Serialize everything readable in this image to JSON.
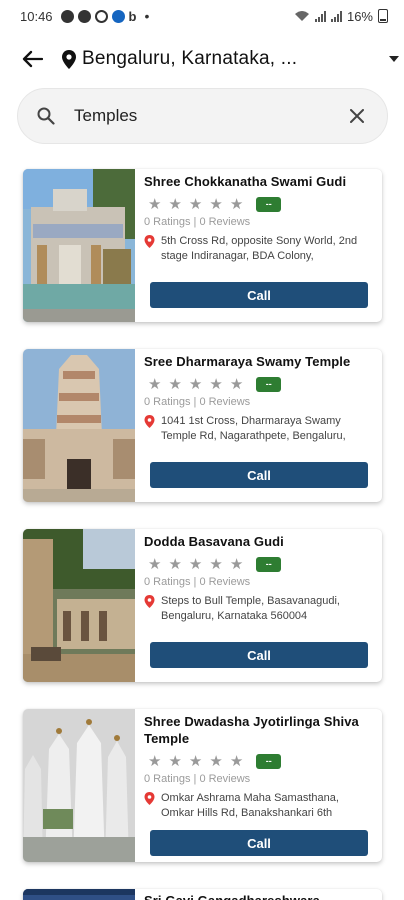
{
  "status_bar": {
    "time": "10:46",
    "extra": "b",
    "dot": "•",
    "battery": "16%"
  },
  "header": {
    "location": "Bengaluru, Karnataka, ..."
  },
  "search": {
    "value": "Temples",
    "placeholder": ""
  },
  "colors": {
    "call_button": "#1f4e79",
    "badge": "#2e7d32",
    "pin": "#e53935"
  },
  "results": [
    {
      "name": "Shree Chokkanatha Swami Gudi",
      "rating_badge": "--",
      "ratings_text": "0 Ratings | 0 Reviews",
      "address": "5th Cross Rd, opposite Sony World, 2nd stage Indiranagar, BDA Colony,",
      "call_label": "Call"
    },
    {
      "name": "Sree Dharmaraya Swamy Temple",
      "rating_badge": "--",
      "ratings_text": "0 Ratings | 0 Reviews",
      "address": "1041 1st Cross, Dharmaraya Swamy Temple Rd, Nagarathpete, Bengaluru,",
      "call_label": "Call"
    },
    {
      "name": "Dodda Basavana Gudi",
      "rating_badge": "--",
      "ratings_text": "0 Ratings | 0 Reviews",
      "address": "Steps to Bull Temple, Basavanagudi, Bengaluru, Karnataka 560004",
      "call_label": "Call"
    },
    {
      "name": "Shree Dwadasha Jyotirlinga Shiva Temple",
      "rating_badge": "--",
      "ratings_text": "0 Ratings | 0 Reviews",
      "address": "Omkar Ashrama Maha Samasthana, Omkar Hills Rd, Banakshankari 6th",
      "call_label": "Call"
    },
    {
      "name": "Sri Gavi Gangadhareshwara"
    }
  ]
}
